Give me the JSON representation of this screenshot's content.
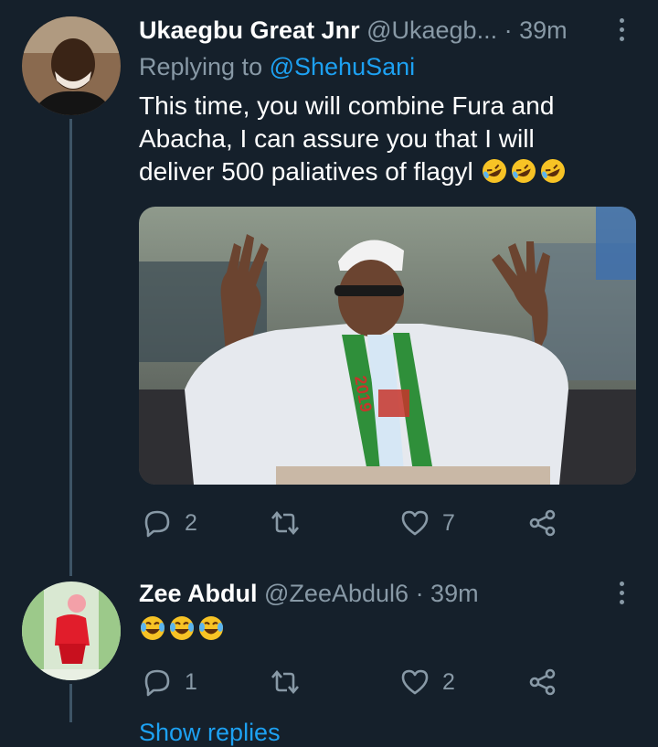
{
  "tweet1": {
    "name": "Ukaegbu Great Jnr",
    "handle": "@Ukaegb...",
    "time": "· 39m",
    "replying_prefix": "Replying to",
    "replying_to": "@ShehuSani",
    "text_line1": "This time, you will combine Fura and",
    "text_line2": "Abacha, I can assure you that I will",
    "text_line3": "deliver 500 paliatives of flagyl",
    "text_emojis": [
      "rolling-on-floor-laughing",
      "rolling-on-floor-laughing",
      "rolling-on-floor-laughing"
    ],
    "media_banner_text": "2019",
    "reply_count": "2",
    "retweet_count": "",
    "like_count": "7"
  },
  "tweet2": {
    "name": "Zee Abdul",
    "handle": "@ZeeAbdul6",
    "time": "· 39m",
    "text_emojis": [
      "face-with-tears-of-joy",
      "face-with-tears-of-joy",
      "face-with-tears-of-joy"
    ],
    "reply_count": "1",
    "retweet_count": "",
    "like_count": "2"
  },
  "show_replies": "Show replies",
  "colors": {
    "background": "#15202b",
    "secondary_text": "#8899a6",
    "link": "#1da1f2",
    "thread_line": "#3d5466"
  }
}
